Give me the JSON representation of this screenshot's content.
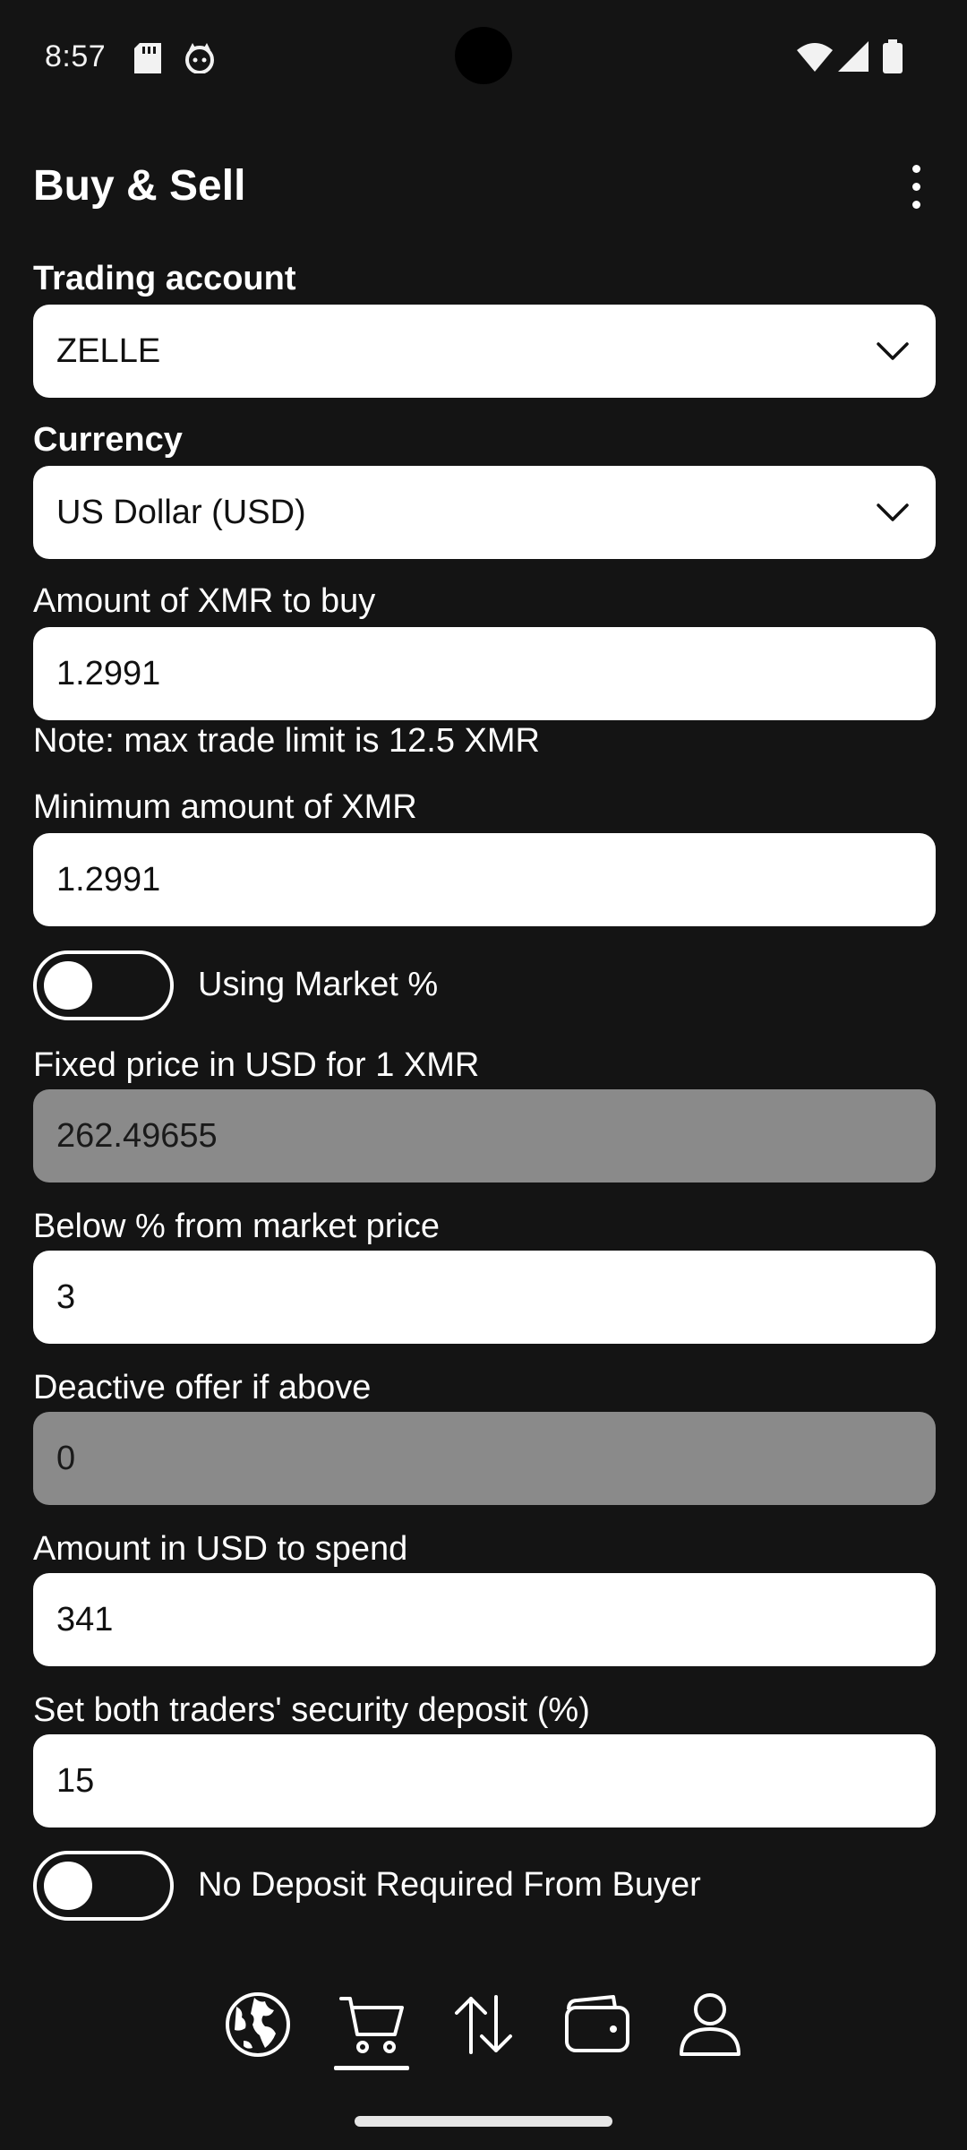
{
  "status_bar": {
    "time": "8:57",
    "icons": [
      "sd-card-icon",
      "notification-cat-icon",
      "wifi-icon",
      "signal-icon",
      "battery-icon"
    ]
  },
  "app_bar": {
    "title": "Buy & Sell",
    "menu_icon": "more-vert-icon"
  },
  "form": {
    "trading_account": {
      "label": "Trading account",
      "value": "ZELLE"
    },
    "currency": {
      "label": "Currency",
      "value": "US Dollar (USD)"
    },
    "amount_xmr": {
      "label": "Amount of XMR to buy",
      "value": "1.2991",
      "note": "Note: max trade limit is 12.5 XMR"
    },
    "min_amount_xmr": {
      "label": "Minimum amount of XMR",
      "value": "1.2991"
    },
    "market_toggle": {
      "label": "Using Market %",
      "on": false
    },
    "fixed_price": {
      "label": "Fixed price in USD for 1 XMR",
      "value": "262.49655",
      "disabled": true
    },
    "below_market": {
      "label": "Below % from market price",
      "value": "3"
    },
    "deactivate_above": {
      "label": "Deactive offer if above",
      "value": "0",
      "disabled": true
    },
    "amount_usd": {
      "label": "Amount in USD to spend",
      "value": "341"
    },
    "security_deposit": {
      "label": "Set both traders' security deposit (%)",
      "value": "15"
    },
    "no_deposit_toggle": {
      "label": "No Deposit Required From Buyer",
      "on": false
    }
  },
  "bottom_nav": {
    "items": [
      "globe-icon",
      "cart-icon",
      "swap-icon",
      "wallet-icon",
      "account-icon"
    ],
    "selected": "cart-icon"
  },
  "colors": {
    "background": "#141414",
    "field": "#ffffff",
    "field_disabled": "#8a8a8a",
    "text": "#ffffff"
  }
}
